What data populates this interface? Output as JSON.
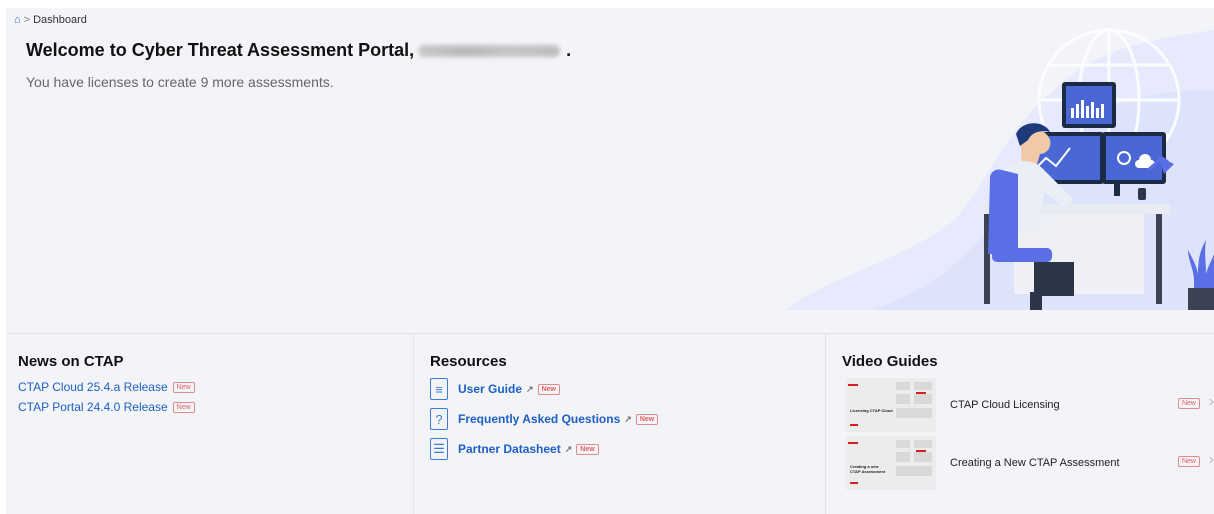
{
  "breadcrumb": {
    "current": "Dashboard"
  },
  "welcome": {
    "title": "Welcome to Cyber Threat Assessment Portal,",
    "suffix": "."
  },
  "licenses_text": "You have licenses to create 9 more assessments.",
  "news": {
    "heading": "News on CTAP",
    "items": [
      {
        "label": "CTAP Cloud 25.4.a Release",
        "badge": "New"
      },
      {
        "label": "CTAP Portal 24.4.0 Release",
        "badge": "New"
      }
    ]
  },
  "resources": {
    "heading": "Resources",
    "items": [
      {
        "label": "User Guide",
        "badge": "New",
        "icon": "document-icon"
      },
      {
        "label": "Frequently Asked Questions",
        "badge": "New",
        "icon": "question-icon"
      },
      {
        "label": "Partner Datasheet",
        "badge": "New",
        "icon": "checklist-icon"
      }
    ]
  },
  "videos": {
    "heading": "Video Guides",
    "items": [
      {
        "title": "CTAP Cloud Licensing",
        "badge": "New",
        "thumb_text": "Licensing CTAP Cloud"
      },
      {
        "title": "Creating a New CTAP Assessment",
        "badge": "New",
        "thumb_text": "Creating a new CTAP Assessment"
      }
    ]
  },
  "colors": {
    "link": "#1d5fc4",
    "badge": "#e06060",
    "background": "#f3f4f8"
  }
}
